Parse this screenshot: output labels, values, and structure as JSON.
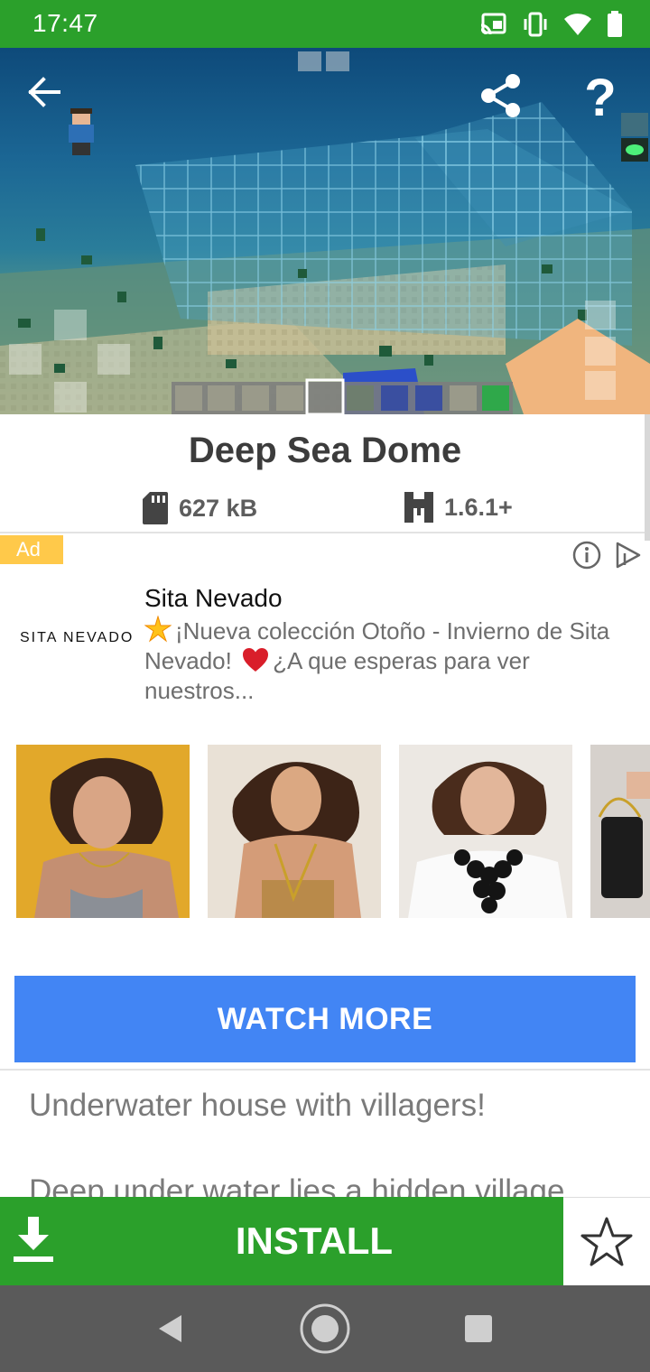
{
  "status_bar": {
    "time": "17:47",
    "icons": [
      "cast-icon",
      "vibrate-icon",
      "wifi-icon",
      "battery-icon"
    ]
  },
  "hero": {
    "back_icon": "arrow-left-icon",
    "share_icon": "share-icon",
    "help_label": "?"
  },
  "app": {
    "title": "Deep Sea Dome",
    "size": "627 kB",
    "version": "1.6.1+"
  },
  "ad": {
    "badge": "Ad",
    "brand_logo": "SITA NEVADO",
    "brand_name": "Sita Nevado",
    "text_part1": "¡Nueva colección Otoño - Invierno de Sita Nevado!",
    "text_part2": "¿A que esperas para ver nuestros...",
    "cta": "WATCH MORE"
  },
  "description": {
    "line1": "Underwater house with villagers!",
    "line2": "Deep under water lies a hidden village"
  },
  "actions": {
    "install": "INSTALL"
  },
  "colors": {
    "primary_green": "#2ba02b",
    "ad_blue": "#4285f4",
    "ad_badge": "#ffc94a",
    "nav_bar": "#5a5a5a"
  }
}
